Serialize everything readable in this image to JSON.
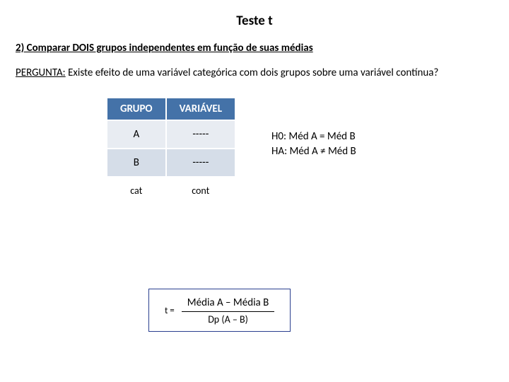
{
  "title": "Teste t",
  "subtitle": "2) Comparar DOIS grupos independentes em função de suas médias",
  "question": {
    "label": "PERGUNTA:",
    "text": " Existe efeito de uma variável categórica com dois grupos sobre uma variável contínua?"
  },
  "table": {
    "headers": {
      "col1": "GRUPO",
      "col2": "VARIÁVEL"
    },
    "rows": [
      {
        "c1": "A",
        "c2": "-----"
      },
      {
        "c1": "B",
        "c2": "-----"
      }
    ],
    "caption": {
      "c1": "cat",
      "c2": "cont"
    }
  },
  "hypotheses": {
    "h0": "H0: Méd A = Méd B",
    "ha": "HA: Méd A ≠ Méd B"
  },
  "formula": {
    "lhs": "t =",
    "numerator": "Média A – Média B",
    "denominator": "Dp (A – B)"
  }
}
